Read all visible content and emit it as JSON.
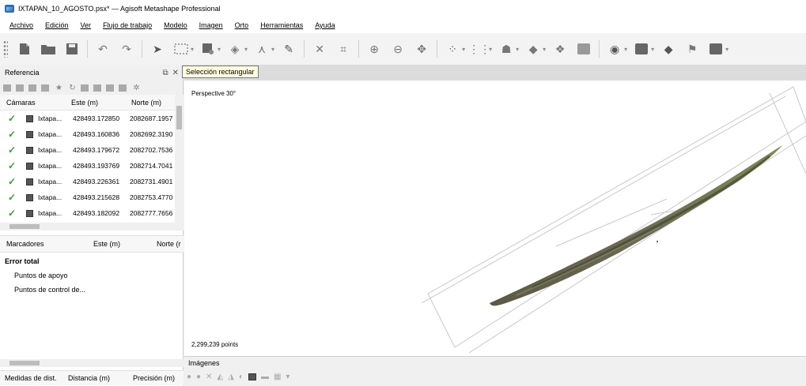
{
  "window": {
    "title": "IXTAPAN_10_AGOSTO.psx* — Agisoft Metashape Professional"
  },
  "menu": [
    "Archivo",
    "Edición",
    "Ver",
    "Flujo de trabajo",
    "Modelo",
    "Imagen",
    "Orto",
    "Herramientas",
    "Ayuda"
  ],
  "toolbar": {
    "icons": [
      "new-icon",
      "open-icon",
      "save-icon",
      "undo-icon",
      "redo-icon",
      "navigation-icon",
      "rectangle-selection-icon",
      "circle-selection-icon",
      "free-form-selection-icon",
      "ruler-icon",
      "shape-icon",
      "delete-icon",
      "crop-icon",
      "zoom-in-icon",
      "zoom-out-icon",
      "move-object-icon",
      "show-cameras-icon",
      "show-points-icon",
      "model-view-icon",
      "surface-icon",
      "texture-icon",
      "shaded-icon",
      "sphere-icon",
      "camera-view-icon",
      "ortho-icon",
      "marker-flag-icon",
      "image-view-icon"
    ],
    "tooltip": "Selección rectangular"
  },
  "reference_panel": {
    "title": "Referencia",
    "cameras_header": {
      "col1": "Cámaras",
      "col2": "Este (m)",
      "col3": "Norte (m)"
    },
    "cameras": [
      {
        "label": "Ixtapa...",
        "este": "428493.172850",
        "norte": "2082687.1957"
      },
      {
        "label": "Ixtapa...",
        "este": "428493.160836",
        "norte": "2082692.3190"
      },
      {
        "label": "Ixtapa...",
        "este": "428493.179672",
        "norte": "2082702.7536"
      },
      {
        "label": "Ixtapa...",
        "este": "428493.193769",
        "norte": "2082714.7041"
      },
      {
        "label": "Ixtapa...",
        "este": "428493.226361",
        "norte": "2082731.4901"
      },
      {
        "label": "Ixtapa...",
        "este": "428493.215628",
        "norte": "2082753.4770"
      },
      {
        "label": "Ixtapa...",
        "este": "428493.182092",
        "norte": "2082777.7656"
      }
    ],
    "markers_header": {
      "col1": "Marcadores",
      "col2": "Este (m)",
      "col3": "Norte (r"
    },
    "markers": {
      "total": "Error total",
      "gcp": "Puntos de apoyo",
      "checkpoints": "Puntos de control de..."
    },
    "scale_header": {
      "col1": "Medidas de dist.",
      "col2": "Distancia (m)",
      "col3": "Precisión (m)"
    }
  },
  "viewport": {
    "projection": "Perspective 30°",
    "points": "2,299,239 points"
  },
  "images_panel": {
    "title": "Imágenes"
  },
  "colors": {
    "check": "#3a9a3a",
    "tooltip_bg": "#ffffe1",
    "accent": "#2c6fb5"
  }
}
